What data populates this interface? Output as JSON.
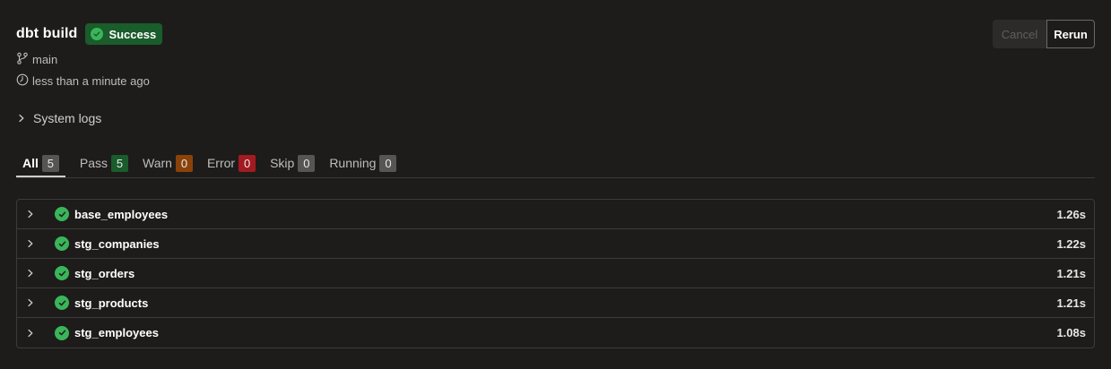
{
  "header": {
    "title": "dbt build",
    "status": "Success",
    "branch": "main",
    "time": "less than a minute ago"
  },
  "actions": {
    "cancel_label": "Cancel",
    "rerun_label": "Rerun"
  },
  "system_logs": {
    "label": "System logs"
  },
  "tabs": [
    {
      "label": "All",
      "count": "5"
    },
    {
      "label": "Pass",
      "count": "5"
    },
    {
      "label": "Warn",
      "count": "0"
    },
    {
      "label": "Error",
      "count": "0"
    },
    {
      "label": "Skip",
      "count": "0"
    },
    {
      "label": "Running",
      "count": "0"
    }
  ],
  "runs": [
    {
      "name": "base_employees",
      "duration": "1.26s"
    },
    {
      "name": "stg_companies",
      "duration": "1.22s"
    },
    {
      "name": "stg_orders",
      "duration": "1.21s"
    },
    {
      "name": "stg_products",
      "duration": "1.21s"
    },
    {
      "name": "stg_employees",
      "duration": "1.08s"
    }
  ],
  "colors": {
    "background": "#1d1c1b",
    "success": "#3ab55a",
    "success_bg": "#1a5c2b",
    "warn_bg": "#8a4208",
    "error_bg": "#a31a20"
  },
  "icons": {
    "status": "check-circle-icon",
    "branch": "git-branch-icon",
    "time": "clock-icon",
    "expand": "chevron-right-icon"
  }
}
